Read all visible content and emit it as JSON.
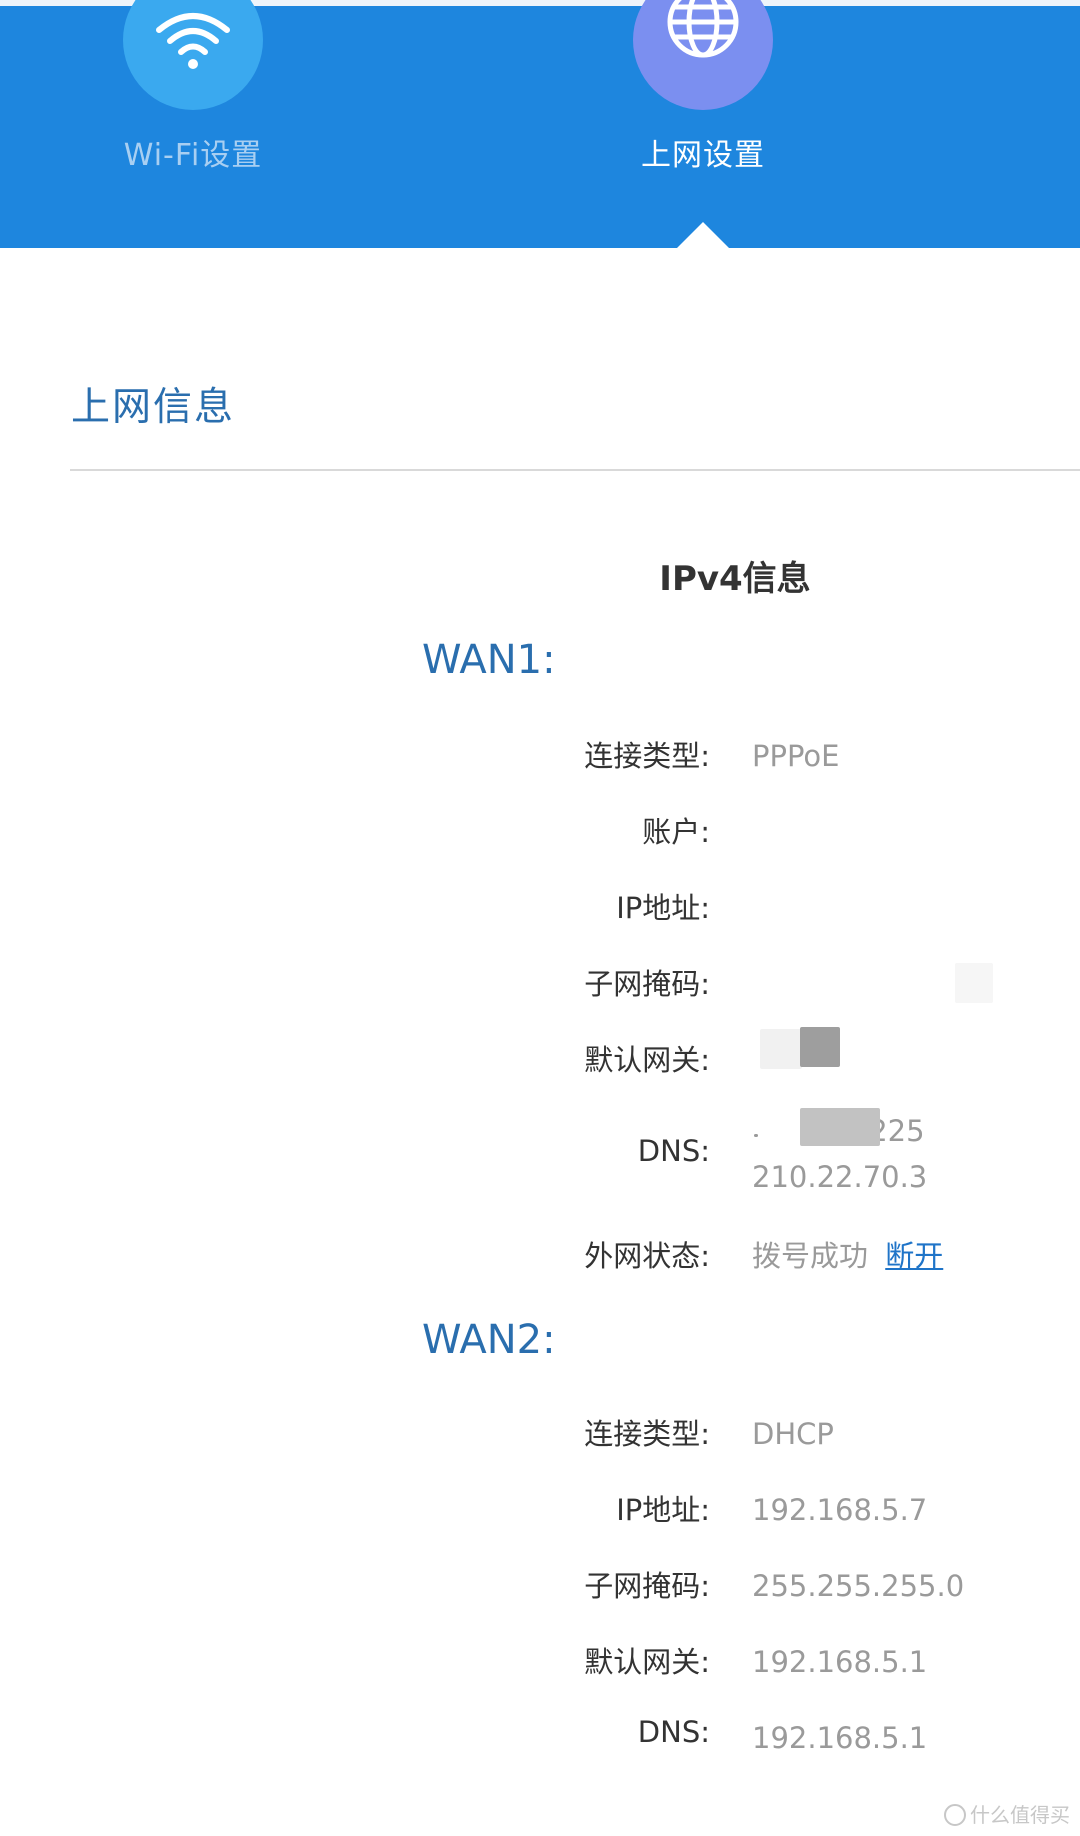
{
  "nav": {
    "items": [
      {
        "label": "Wi-Fi设置",
        "icon": "wifi-icon"
      },
      {
        "label": "上网设置",
        "icon": "globe-icon",
        "active": true
      }
    ]
  },
  "section": {
    "title": "上网信息"
  },
  "ipv4": {
    "heading": "IPv4信息"
  },
  "wan1": {
    "heading": "WAN1:",
    "rows": [
      {
        "label": "连接类型:",
        "value": "PPPoE"
      },
      {
        "label": "账户:",
        "value": ""
      },
      {
        "label": "IP地址:",
        "value": ""
      },
      {
        "label": "子网掩码:",
        "value": ""
      },
      {
        "label": "默认网关:",
        "value": ""
      },
      {
        "label": "DNS:",
        "value": ".225",
        "value2": "210.22.70.3"
      },
      {
        "label": "外网状态:",
        "value": "拨号成功",
        "action": "断开"
      }
    ]
  },
  "wan2": {
    "heading": "WAN2:",
    "rows": [
      {
        "label": "连接类型:",
        "value": "DHCP"
      },
      {
        "label": "IP地址:",
        "value": "192.168.5.7"
      },
      {
        "label": "子网掩码:",
        "value": "255.255.255.0"
      },
      {
        "label": "默认网关:",
        "value": "192.168.5.1"
      },
      {
        "label": "DNS:",
        "value": "192.168.5.1"
      }
    ]
  },
  "watermark": {
    "text": "什么值得买"
  },
  "colors": {
    "topbar": "#1e86de",
    "accent_text": "#2a6eae",
    "link": "#1f74c8",
    "value_text": "#9a9a9a"
  }
}
